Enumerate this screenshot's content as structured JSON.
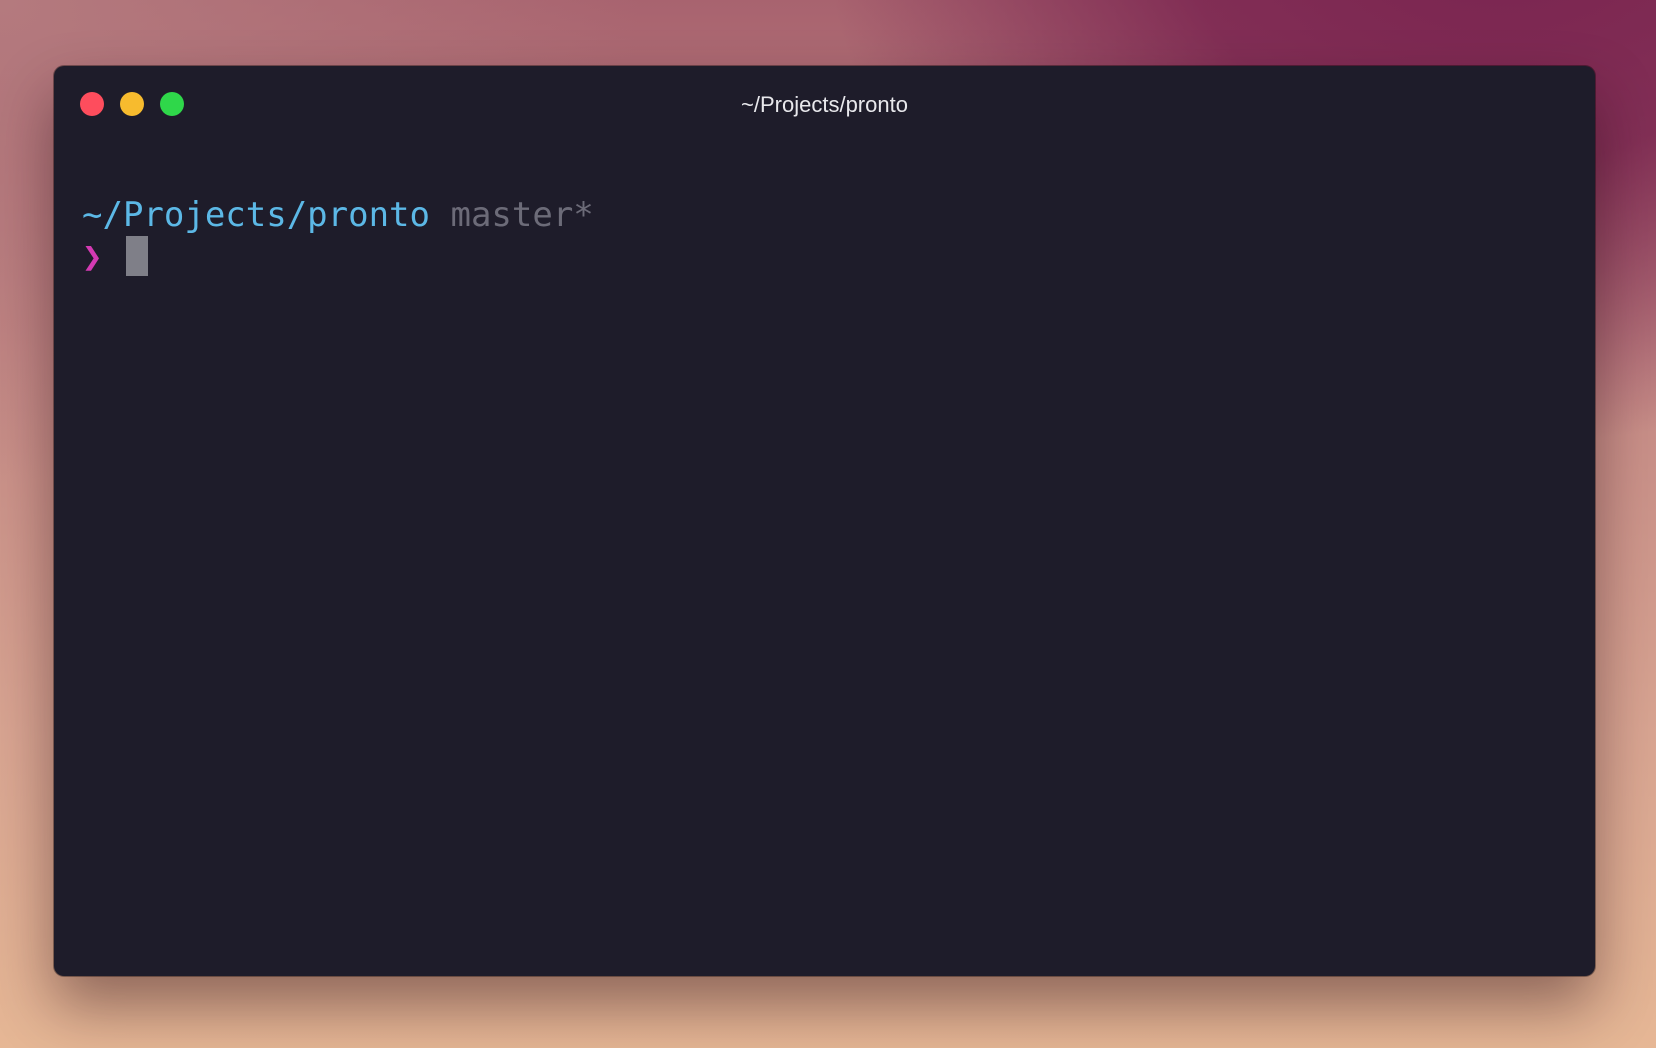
{
  "window": {
    "title": "~/Projects/pronto"
  },
  "terminal": {
    "cwd": "~/Projects/pronto",
    "branch": "master*",
    "prompt_symbol": "❯"
  },
  "colors": {
    "close": "#fe4d5d",
    "minimize": "#f7bb2e",
    "zoom": "#2fd74a",
    "background": "#1e1c2a",
    "cwd": "#5cb8e6",
    "branch": "#6c6b78",
    "prompt": "#d43ab3",
    "cursor": "#7f7f88"
  }
}
